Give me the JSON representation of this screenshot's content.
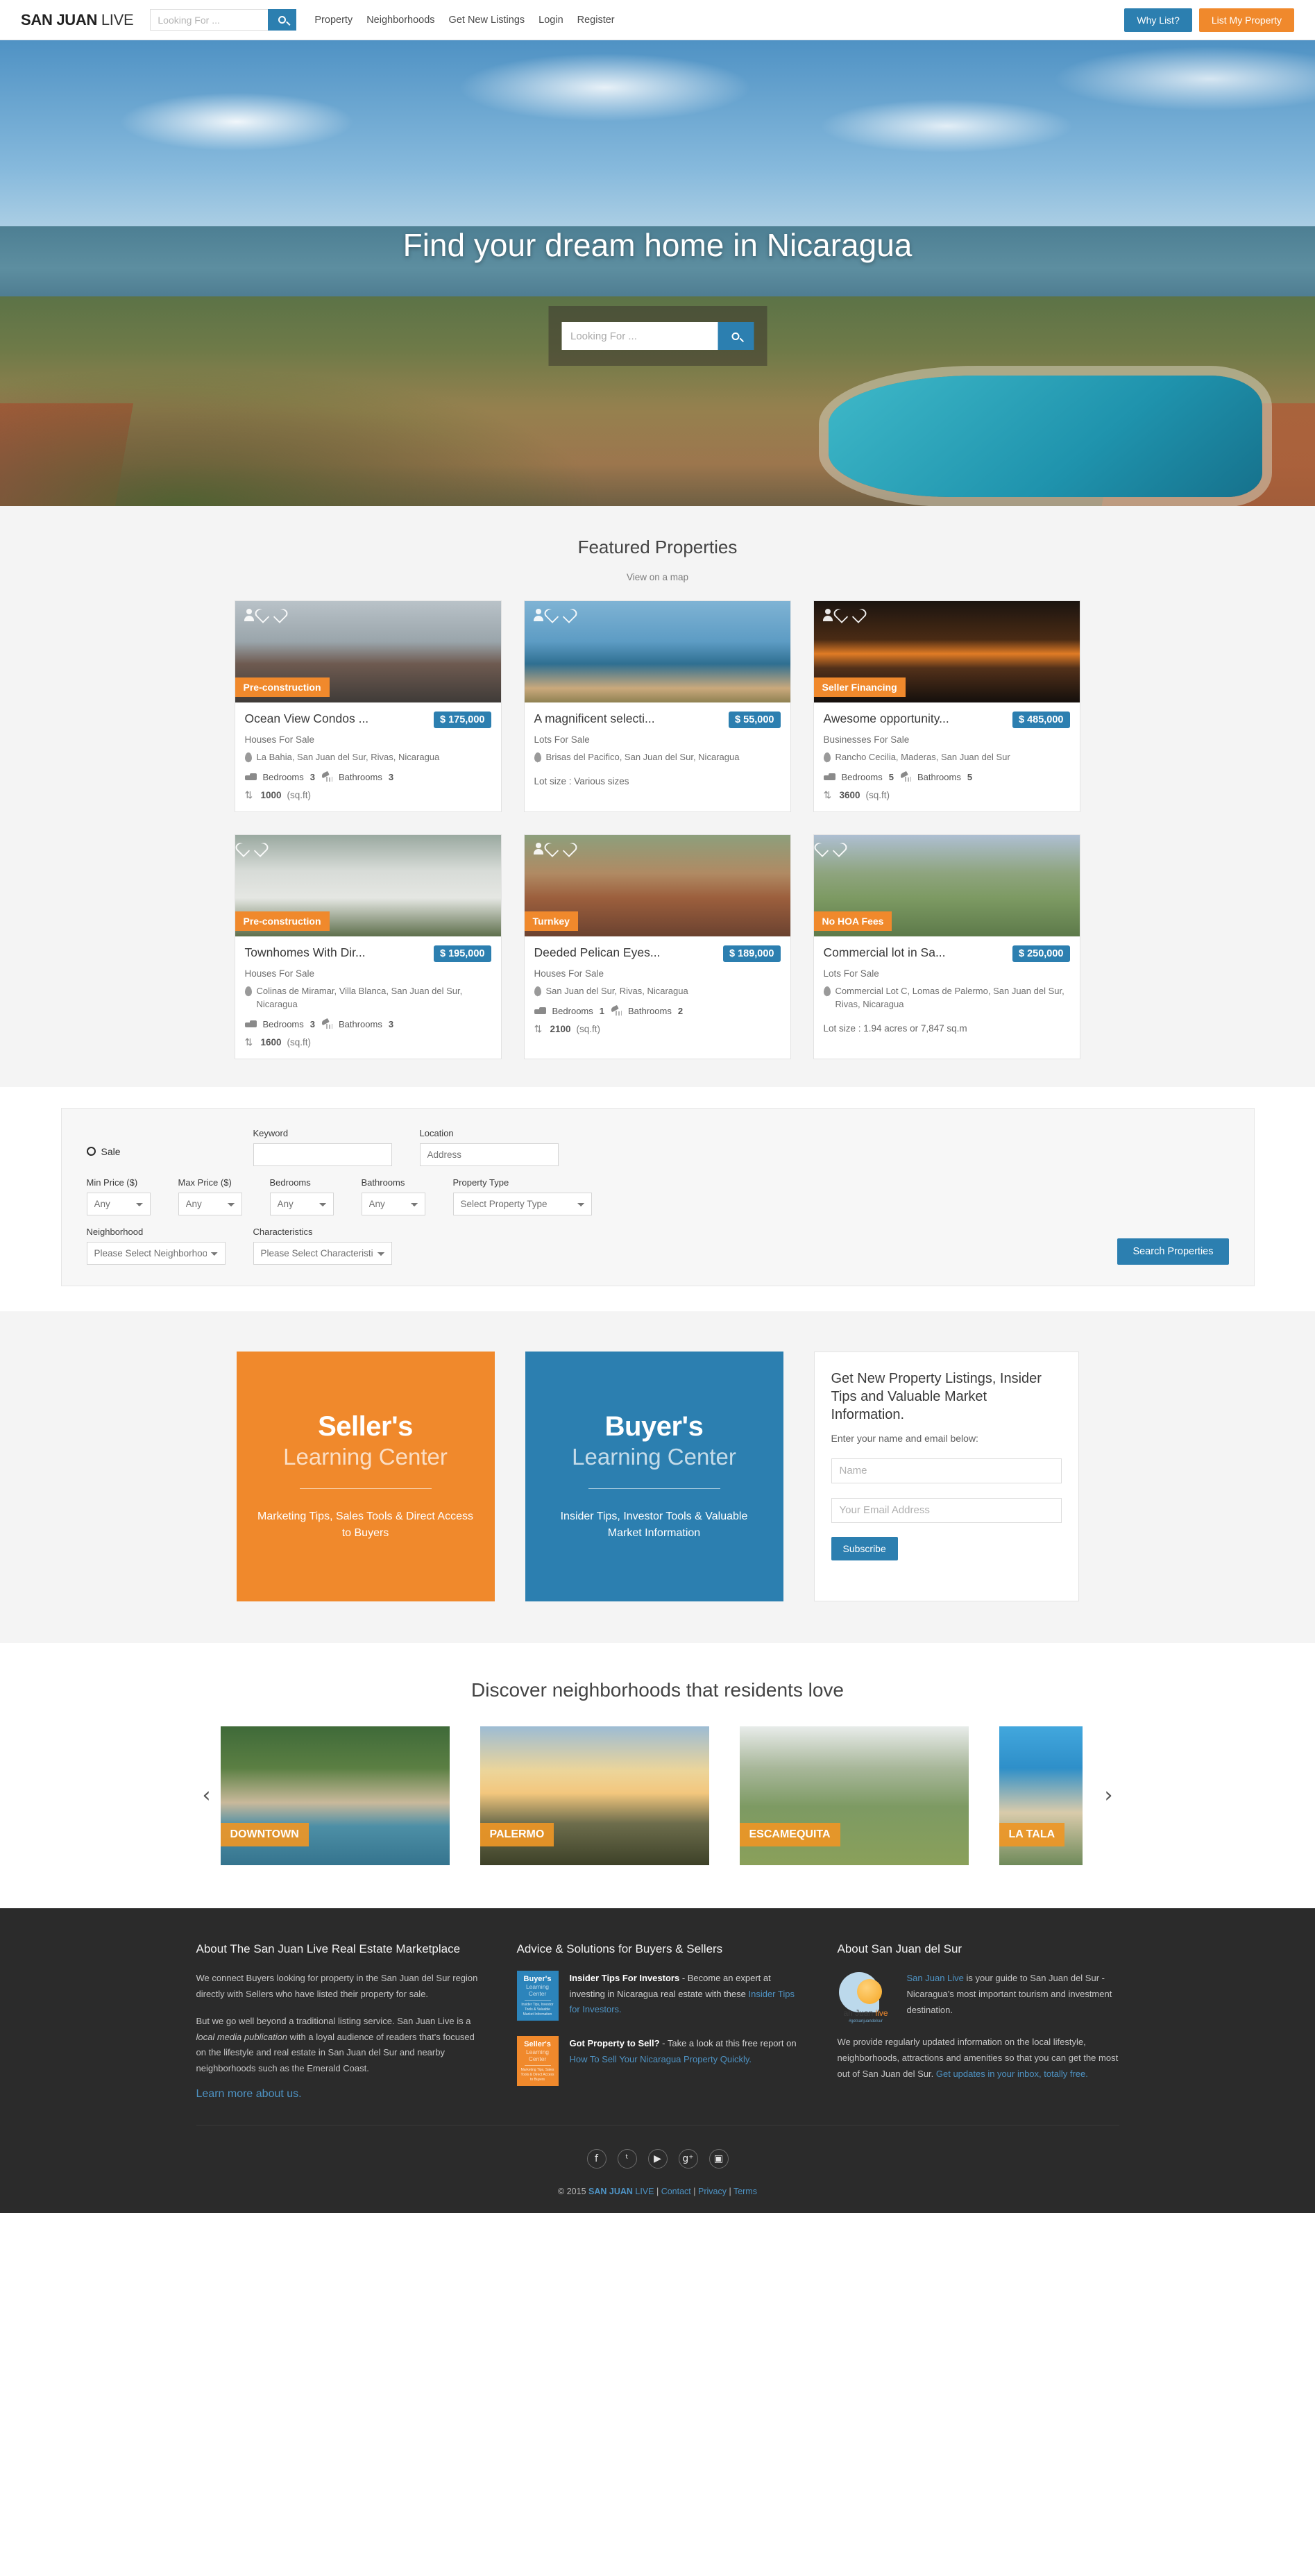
{
  "header": {
    "brand_bold": "SAN JUAN",
    "brand_light": "LIVE",
    "search_placeholder": "Looking For ...",
    "search_value": "",
    "nav": [
      {
        "label": "Property"
      },
      {
        "label": "Neighborhoods"
      },
      {
        "label": "Get New Listings"
      },
      {
        "label": "Login"
      },
      {
        "label": "Register"
      }
    ],
    "why_list_label": "Why List?",
    "list_property_label": "List My Property",
    "accent_blue": "#2c7fb0",
    "accent_orange": "#f0892c"
  },
  "hero": {
    "title": "Find your dream home in Nicaragua",
    "search_placeholder": "Looking For ...",
    "search_value": ""
  },
  "featured": {
    "title": "Featured Properties",
    "view_map_label": "View on a map",
    "properties": [
      {
        "badge": "Pre-construction",
        "title": "Ocean View Condos ...",
        "price": "$ 175,000",
        "type": "Houses For Sale",
        "location": "La Bahia, San Juan del Sur, Rivas, Nicaragua",
        "bedrooms_label": "Bedrooms",
        "bedrooms": "3",
        "bathrooms_label": "Bathrooms",
        "bathrooms": "3",
        "area": "1000",
        "area_unit": "(sq.ft)",
        "lot_size": "",
        "has_person_icon": true
      },
      {
        "badge": "",
        "title": "A magnificent selecti...",
        "price": "$ 55,000",
        "type": "Lots For Sale",
        "location": "Brisas del Pacifico, San Juan del Sur, Nicaragua",
        "bedrooms_label": "",
        "bedrooms": "",
        "bathrooms_label": "",
        "bathrooms": "",
        "area": "",
        "area_unit": "",
        "lot_size": "Lot size : Various sizes",
        "has_person_icon": true
      },
      {
        "badge": "Seller Financing",
        "title": "Awesome opportunity...",
        "price": "$ 485,000",
        "type": "Businesses For Sale",
        "location": "Rancho Cecilia, Maderas, San Juan del Sur",
        "bedrooms_label": "Bedrooms",
        "bedrooms": "5",
        "bathrooms_label": "Bathrooms",
        "bathrooms": "5",
        "area": "3600",
        "area_unit": "(sq.ft)",
        "lot_size": "",
        "has_person_icon": true
      },
      {
        "badge": "Pre-construction",
        "title": "Townhomes With Dir...",
        "price": "$ 195,000",
        "type": "Houses For Sale",
        "location": "Colinas de Miramar, Villa Blanca, San Juan del Sur, Nicaragua",
        "bedrooms_label": "Bedrooms",
        "bedrooms": "3",
        "bathrooms_label": "Bathrooms",
        "bathrooms": "3",
        "area": "1600",
        "area_unit": "(sq.ft)",
        "lot_size": "",
        "has_person_icon": false
      },
      {
        "badge": "Turnkey",
        "title": "Deeded Pelican Eyes...",
        "price": "$ 189,000",
        "type": "Houses For Sale",
        "location": "San Juan del Sur, Rivas, Nicaragua",
        "bedrooms_label": "Bedrooms",
        "bedrooms": "1",
        "bathrooms_label": "Bathrooms",
        "bathrooms": "2",
        "area": "2100",
        "area_unit": "(sq.ft)",
        "lot_size": "",
        "has_person_icon": true
      },
      {
        "badge": "No HOA Fees",
        "title": "Commercial lot in Sa...",
        "price": "$ 250,000",
        "type": "Lots For Sale",
        "location": "Commercial Lot C, Lomas de Palermo, San Juan del Sur, Rivas, Nicaragua",
        "bedrooms_label": "",
        "bedrooms": "",
        "bathrooms_label": "",
        "bathrooms": "",
        "area": "",
        "area_unit": "",
        "lot_size": "Lot size : 1.94 acres or 7,847 sq.m",
        "has_person_icon": false
      }
    ]
  },
  "search_panel": {
    "sale_label": "Sale",
    "keyword_label": "Keyword",
    "keyword_value": "",
    "location_label": "Location",
    "location_placeholder": "Address",
    "min_price_label": "Min Price ($)",
    "min_price_value": "Any",
    "max_price_label": "Max Price ($)",
    "max_price_value": "Any",
    "bedrooms_label": "Bedrooms",
    "bedrooms_value": "Any",
    "bathrooms_label": "Bathrooms",
    "bathrooms_value": "Any",
    "property_type_label": "Property Type",
    "property_type_value": "Select Property Type",
    "neighborhood_label": "Neighborhood",
    "neighborhood_value": "Please Select Neighborhood",
    "characteristics_label": "Characteristics",
    "characteristics_value": "Please Select Characteristics",
    "search_button_label": "Search Properties"
  },
  "learning": {
    "seller": {
      "h1": "Seller's",
      "h2": "Learning Center",
      "sub": "Marketing Tips, Sales Tools & Direct Access to Buyers",
      "color": "#f0892c"
    },
    "buyer": {
      "h1": "Buyer's",
      "h2": "Learning Center",
      "sub": "Insider Tips, Investor Tools & Valuable Market Information",
      "color": "#2c7fb0"
    },
    "newsletter": {
      "heading": "Get New Property Listings, Insider Tips and Valuable Market Information.",
      "sub": "Enter your name and email below:",
      "name_placeholder": "Name",
      "name_value": "",
      "email_placeholder": "Your Email Address",
      "email_value": "",
      "subscribe_label": "Subscribe"
    }
  },
  "neighborhoods": {
    "title": "Discover neighborhoods that residents love",
    "prev_arrow": "‹",
    "next_arrow": "›",
    "items": [
      {
        "label": "DOWNTOWN"
      },
      {
        "label": "PALERMO"
      },
      {
        "label": "ESCAMEQUITA"
      },
      {
        "label": "LA TALA"
      }
    ]
  },
  "footer": {
    "about_marketplace": {
      "heading": "About The San Juan Live Real Estate Marketplace",
      "p1": "We connect Buyers looking for property in the San Juan del Sur region directly with Sellers who have listed their property for sale.",
      "p2_a": "But we go well beyond a traditional listing service. San Juan Live is a ",
      "p2_em": "local media publication",
      "p2_b": " with a loyal audience of readers that's focused on the lifestyle and real estate in San Juan del Sur and nearby neighborhoods such as the Emerald Coast.",
      "learn_more": "Learn more about us."
    },
    "advice": {
      "heading": "Advice & Solutions for Buyers & Sellers",
      "items": [
        {
          "thumb_h1": "Buyer's",
          "thumb_h2": "Learning Center",
          "thumb_sub": "Insider Tips, Investor Tools & Valuable Market Information",
          "thumb_color": "blue",
          "bold": "Insider Tips For Investors",
          "text": " - Become an expert at investing in Nicaragua real estate with these ",
          "link": "Insider Tips for Investors."
        },
        {
          "thumb_h1": "Seller's",
          "thumb_h2": "Learning Center",
          "thumb_sub": "Marketing Tips, Sales Tools & Direct Access to Buyers",
          "thumb_color": "orange",
          "bold": "Got Property to Sell?",
          "text": " - Take a look at this free report on ",
          "link": "How To Sell Your Nicaragua Property Quickly."
        }
      ]
    },
    "about_sjds": {
      "heading": "About San Juan del Sur",
      "logo_text_a": "an Juan ",
      "logo_text_b": "live",
      "logo_tag": "#getsanjuandelsur",
      "p1_link": "San Juan Live",
      "p1_text": " is your guide to San Juan del Sur - Nicaragua's most important tourism and investment destination.",
      "p2_text": "We provide regularly updated information on the local lifestyle, neighborhoods, attractions and amenities so that you can get the most out of San Juan del Sur. ",
      "p2_link": "Get updates in your inbox, totally free."
    },
    "socials": [
      {
        "name": "facebook-icon",
        "glyph": "f"
      },
      {
        "name": "twitter-icon",
        "glyph": "ᵗ"
      },
      {
        "name": "youtube-icon",
        "glyph": "▶"
      },
      {
        "name": "googleplus-icon",
        "glyph": "g⁺"
      },
      {
        "name": "instagram-icon",
        "glyph": "▣"
      }
    ],
    "copyright": {
      "prefix": "© 2015 ",
      "brand_bold": "SAN JUAN",
      "brand_light": " LIVE",
      "sep1": " | ",
      "contact": "Contact",
      "sep2": " | ",
      "privacy": "Privacy",
      "sep3": " | ",
      "terms": "Terms"
    }
  }
}
